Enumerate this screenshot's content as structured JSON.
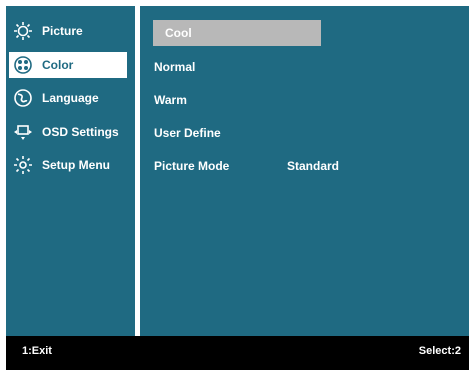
{
  "sidebar": {
    "items": [
      {
        "label": "Picture",
        "icon": "sun-icon"
      },
      {
        "label": "Color",
        "icon": "palette-icon"
      },
      {
        "label": "Language",
        "icon": "globe-icon"
      },
      {
        "label": "OSD Settings",
        "icon": "osd-settings-icon"
      },
      {
        "label": "Setup Menu",
        "icon": "gear-icon"
      }
    ],
    "selected": "Color"
  },
  "main": {
    "items": [
      {
        "label": "Cool",
        "value": ""
      },
      {
        "label": "Normal",
        "value": ""
      },
      {
        "label": "Warm",
        "value": ""
      },
      {
        "label": "User Define",
        "value": ""
      },
      {
        "label": "Picture Mode",
        "value": "Standard"
      }
    ],
    "selected": "Cool"
  },
  "footer": {
    "exit_label": "1:Exit",
    "select_label": "Select:2"
  },
  "colors": {
    "panel": "#1f6a82",
    "highlight_main": "#b8b8b8",
    "highlight_side": "#ffffff",
    "footer": "#000000"
  }
}
